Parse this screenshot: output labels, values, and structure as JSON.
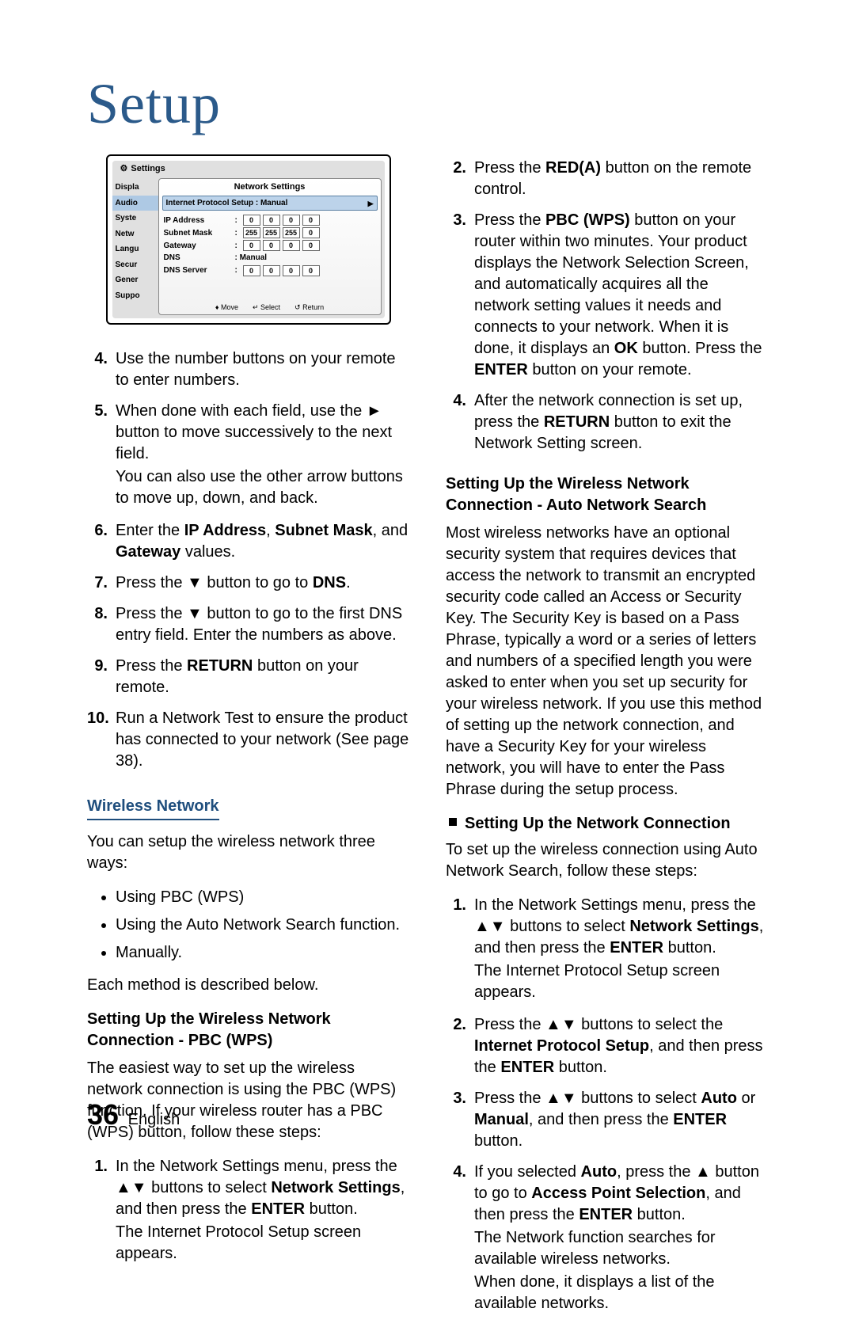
{
  "page": {
    "title": "Setup",
    "number": "36",
    "language": "English"
  },
  "settings_panel": {
    "header": "Settings",
    "sidebar_items": [
      "Displa",
      "Audio",
      "Syste",
      "Netw",
      "Langu",
      "Secur",
      "Gener",
      "Suppo"
    ],
    "dialog_title": "Network Settings",
    "ips_label": "Internet Protocol Setup : Manual",
    "rows": {
      "ip_label": "IP Address",
      "ip": [
        "0",
        "0",
        "0",
        "0"
      ],
      "subnet_label": "Subnet Mask",
      "subnet": [
        "255",
        "255",
        "255",
        "0"
      ],
      "gateway_label": "Gateway",
      "gateway": [
        "0",
        "0",
        "0",
        "0"
      ],
      "dns_label": "DNS",
      "dns_value": ": Manual",
      "dns_server_label": "DNS Server",
      "dns_server": [
        "0",
        "0",
        "0",
        "0"
      ]
    },
    "footer": {
      "move": "Move",
      "select": "Select",
      "return": "Return"
    }
  },
  "left": {
    "steps": {
      "s4": "Use the number buttons on your remote to enter numbers.",
      "s5a": "When done with each field, use the ► button to move successively to the next field.",
      "s5b": "You can also use the other arrow buttons to move up, down, and back.",
      "s6_pre": "Enter the ",
      "s6_ip": "IP Address",
      "s6_mid1": ", ",
      "s6_sm": "Subnet Mask",
      "s6_mid2": ", and ",
      "s6_gw": "Gateway",
      "s6_post": " values.",
      "s7_pre": "Press the ▼ button to go to ",
      "s7_dns": "DNS",
      "s7_post": ".",
      "s8": "Press the ▼ button to go to the first DNS entry field. Enter the numbers as above.",
      "s9_pre": "Press the ",
      "s9_ret": "RETURN",
      "s9_post": " button on your remote.",
      "s10": "Run a Network Test to ensure the product has connected to your network (See page 38)."
    },
    "wireless_heading": "Wireless Network",
    "wireless_intro": "You can setup the wireless network three ways:",
    "bullets": {
      "b1": "Using PBC (WPS)",
      "b2": "Using the Auto Network Search function.",
      "b3": "Manually."
    },
    "wireless_outro": "Each method is described below.",
    "pbc_heading": "Setting Up the Wireless Network Connection - PBC (WPS)",
    "pbc_intro": "The easiest way to set up the wireless network connection is using the PBC (WPS) function. If your wireless router has a PBC (WPS) button, follow these steps:",
    "pbc_steps": {
      "s1_a": "In the Network Settings menu, press the ▲▼ buttons to select ",
      "s1_ns": "Network Settings",
      "s1_b": ", and then press the ",
      "s1_enter": "ENTER",
      "s1_c": " button.",
      "s1_d": "The Internet Protocol Setup screen appears."
    }
  },
  "right": {
    "steps": {
      "s2_pre": "Press the ",
      "s2_red": "RED(A)",
      "s2_post": " button on the remote control.",
      "s3_a": "Press the ",
      "s3_pbc": "PBC (WPS)",
      "s3_b": " button on your router within two minutes. Your product displays the Network Selection Screen, and automatically acquires all the network setting values it needs and connects to your network. When it is done, it displays an ",
      "s3_ok": "OK",
      "s3_c": " button. Press the ",
      "s3_enter": "ENTER",
      "s3_d": " button on your remote.",
      "s4_a": "After the network connection is set up, press the ",
      "s4_ret": "RETURN",
      "s4_b": " button to exit the Network Setting screen."
    },
    "auto_heading": "Setting Up the Wireless Network Connection - Auto Network Search",
    "auto_body": "Most wireless networks have an optional security system that requires devices that access the network to transmit an encrypted security code called an Access or Security Key. The Security Key is based on a Pass Phrase, typically a word or a series of letters and numbers of a specified length you were asked to enter when you set up security for your wireless network. If you use this method of setting up the network connection, and have a Security Key for your wireless network, you will have to enter the Pass Phrase during the setup process.",
    "setup_conn_heading": "Setting Up the Network Connection",
    "auto_intro": "To set up the wireless connection using Auto Network Search, follow these steps:",
    "auto_steps": {
      "s1_a": "In the Network Settings menu, press the ▲▼ buttons to select ",
      "s1_ns": "Network Settings",
      "s1_b": ", and then press the ",
      "s1_enter": "ENTER",
      "s1_c": " button.",
      "s1_d": "The Internet Protocol Setup screen appears.",
      "s2_a": "Press the ▲▼ buttons to select the ",
      "s2_ips": "Internet Protocol Setup",
      "s2_b": ", and then press the ",
      "s2_enter": "ENTER",
      "s2_c": " button.",
      "s3_a": "Press the ▲▼ buttons to select ",
      "s3_auto": "Auto",
      "s3_b": " or ",
      "s3_manual": "Manual",
      "s3_c": ", and then press the ",
      "s3_enter": "ENTER",
      "s3_d": " button.",
      "s4_a": "If you selected ",
      "s4_auto": "Auto",
      "s4_b": ", press the ▲ button to go to ",
      "s4_aps": "Access Point Selection",
      "s4_c": ", and then press the ",
      "s4_enter": "ENTER",
      "s4_d": " button.",
      "s4_e": "The Network function searches for available wireless networks.",
      "s4_f": "When done, it displays a list of the available networks."
    }
  }
}
